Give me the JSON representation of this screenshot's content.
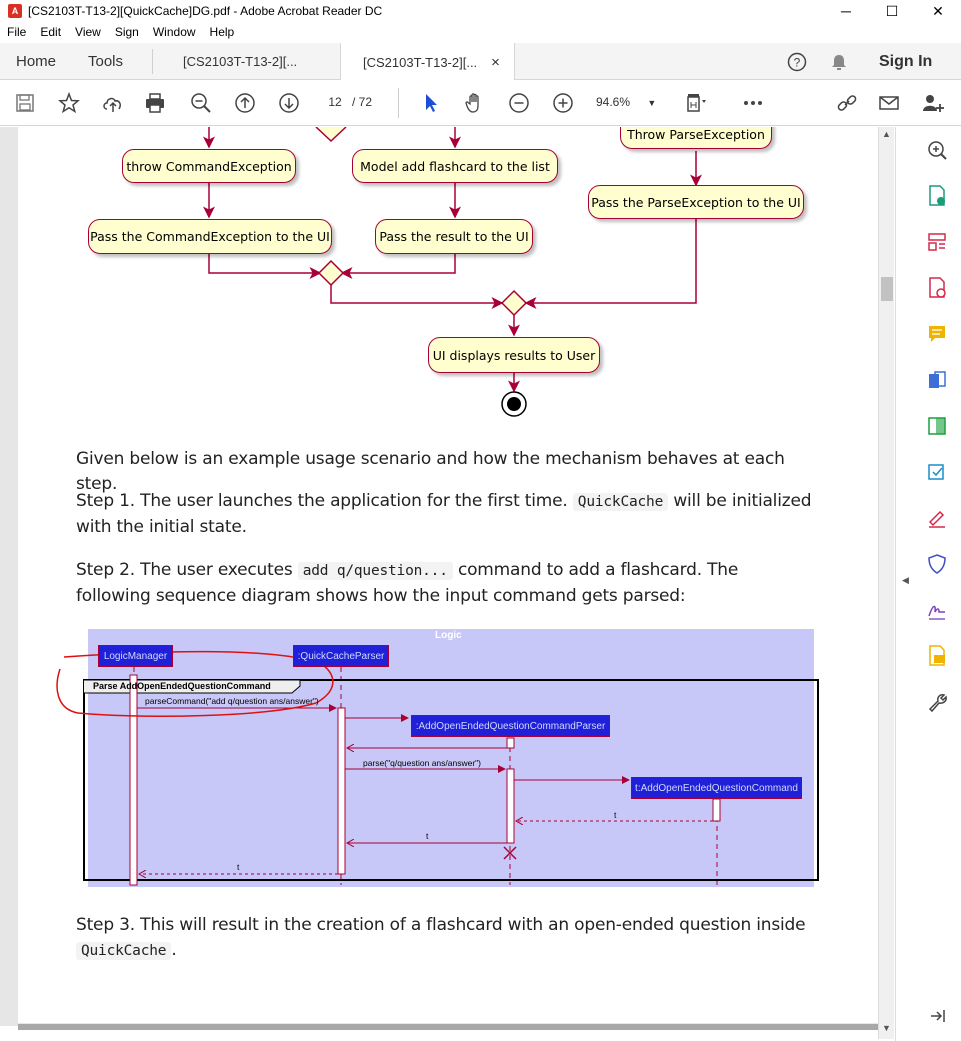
{
  "window": {
    "title": "[CS2103T-T13-2][QuickCache]DG.pdf - Adobe Acrobat Reader DC",
    "minimize": "─",
    "maximize": "☐",
    "close": "✕"
  },
  "menu": [
    "File",
    "Edit",
    "View",
    "Sign",
    "Window",
    "Help"
  ],
  "tabs": {
    "home": "Home",
    "tools": "Tools",
    "doc1": "[CS2103T-T13-2][...",
    "doc2": "[CS2103T-T13-2][...",
    "close": "×",
    "sign_in": "Sign In"
  },
  "toolbar": {
    "page_current": "12",
    "page_total": "/ 72",
    "zoom": "94.6%"
  },
  "activity": {
    "throw_parse": "Throw ParseException",
    "throw_command": "throw CommandException",
    "model_add": "Model add flashcard to the list",
    "pass_parse": "Pass the ParseException to the UI",
    "pass_command": "Pass the CommandException to the UI",
    "pass_result": "Pass the result to the UI",
    "ui_displays": "UI displays results to User"
  },
  "text": {
    "intro": "Given below is an example usage scenario and how the mechanism behaves at each step.",
    "step1_a": "Step 1. The user launches the application for the first time.",
    "step1_code": "QuickCache",
    "step1_b": "will be initialized with the initial state.",
    "step2_a": "Step 2. The user executes",
    "step2_code": "add q/question...",
    "step2_b": "command to add a flashcard. The following sequence diagram shows how the input command gets parsed:",
    "step3_a": "Step 3. This will result in the creation of a flashcard with an open-ended question inside",
    "step3_code": "QuickCache",
    "step3_b": "."
  },
  "sequence": {
    "box_title": "Logic",
    "logic_manager": "LogicManager",
    "parser": ":QuickCacheParser",
    "frame_label": "Parse AddOpenEndedQuestionCommand",
    "msg_parse_command": "parseCommand(\"add q/question ans/answer\")",
    "cmd_parser": ":AddOpenEndedQuestionCommandParser",
    "msg_parse": "parse(\"q/question ans/answer\")",
    "command": "t:AddOpenEndedQuestionCommand",
    "ret_t1": "t",
    "ret_t2": "t",
    "ret_t3": "t"
  }
}
